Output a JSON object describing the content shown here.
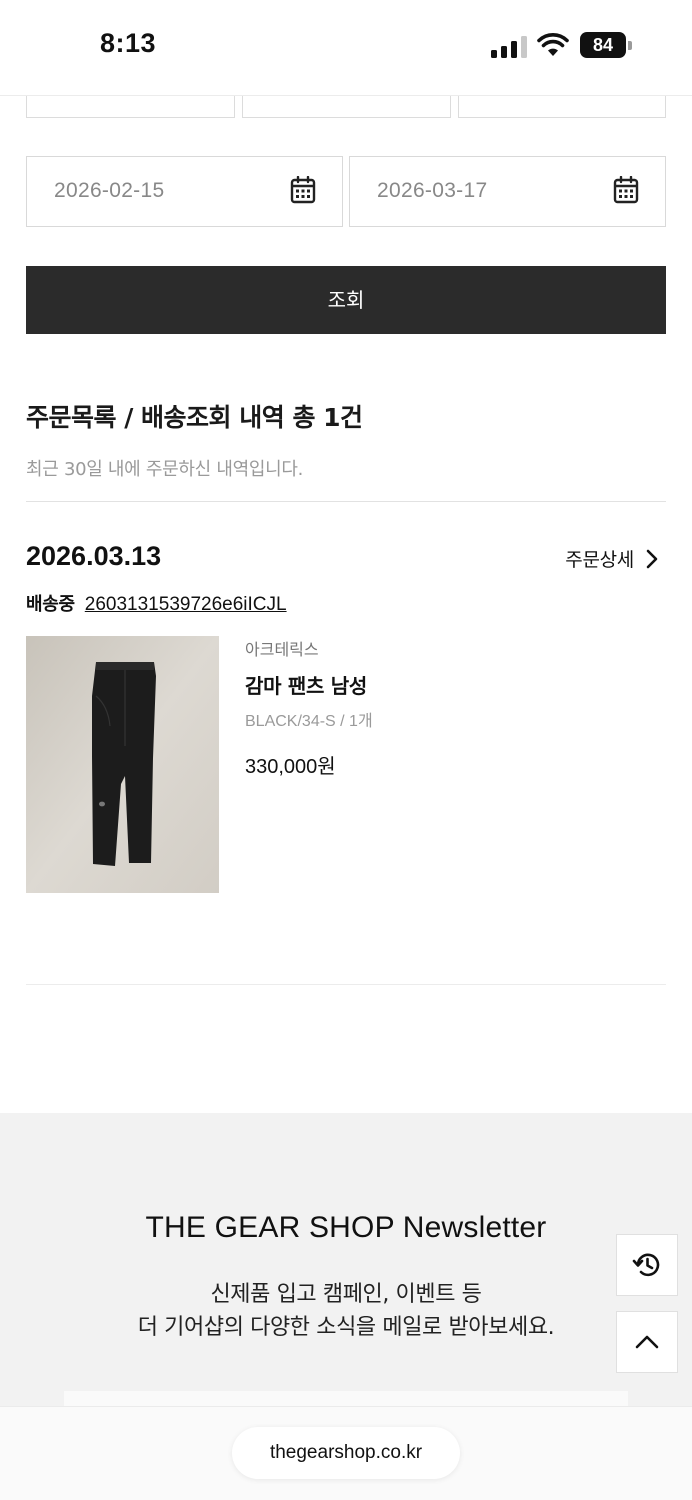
{
  "status_bar": {
    "time": "8:13",
    "battery": "84"
  },
  "filter": {
    "start_date": "2026-02-15",
    "end_date": "2026-03-17",
    "search_label": "조회"
  },
  "order_list": {
    "title": "주문목록 / 배송조회 내역 총 1건",
    "subtitle": "최근 30일 내에 주문하신 내역입니다."
  },
  "order": {
    "date": "2026.03.13",
    "detail_label": "주문상세",
    "status": "배송중",
    "order_number": "2603131539726e6iICJL",
    "product": {
      "brand": "아크테릭스",
      "name": "감마 팬츠 남성",
      "option": "BLACK/34-S / 1개",
      "price": "330,000원"
    }
  },
  "newsletter": {
    "title": "THE GEAR SHOP Newsletter",
    "line1": "신제품 입고 캠페인, 이벤트 등",
    "line2": "더 기어샵의 다양한 소식을 메일로 받아보세요."
  },
  "browser": {
    "url": "thegearshop.co.kr"
  },
  "icons": {
    "calendar": "calendar-icon",
    "chevron": "chevron-right-icon",
    "history": "history-icon",
    "scroll_top": "chevron-up-icon"
  }
}
